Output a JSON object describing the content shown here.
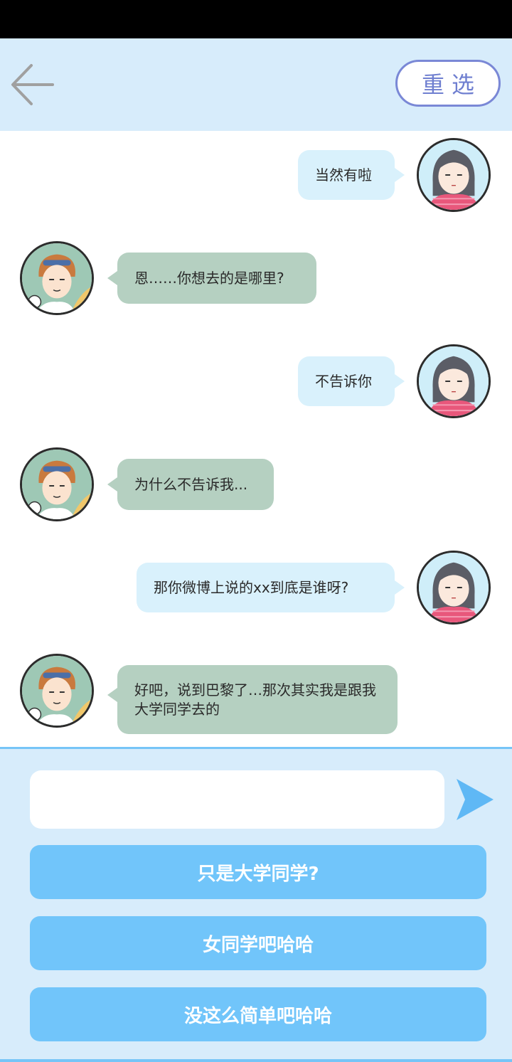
{
  "header": {
    "reselect_label": "重选"
  },
  "messages": [
    {
      "sender": "me",
      "text": "当然有啦"
    },
    {
      "sender": "other",
      "text": "恩……你想去的是哪里?"
    },
    {
      "sender": "me",
      "text": "不告诉你"
    },
    {
      "sender": "other",
      "text": "为什么不告诉我..."
    },
    {
      "sender": "me",
      "text": "那你微博上说的xx到底是谁呀?"
    },
    {
      "sender": "other",
      "text": "好吧，说到巴黎了…那次其实我是跟我大学同学去的"
    }
  ],
  "composer": {
    "value": "",
    "placeholder": ""
  },
  "options": [
    {
      "label": "只是大学同学?"
    },
    {
      "label": "女同学吧哈哈"
    },
    {
      "label": "没这么简单吧哈哈"
    }
  ],
  "colors": {
    "header_bg": "#d7ecfb",
    "my_bubble": "#d9f1fc",
    "other_bubble": "#b5d0c1",
    "option_bg": "#71c5fa",
    "reselect_border": "#7a88d6"
  },
  "icons": {
    "back": "arrow-left-icon",
    "send": "send-icon"
  }
}
